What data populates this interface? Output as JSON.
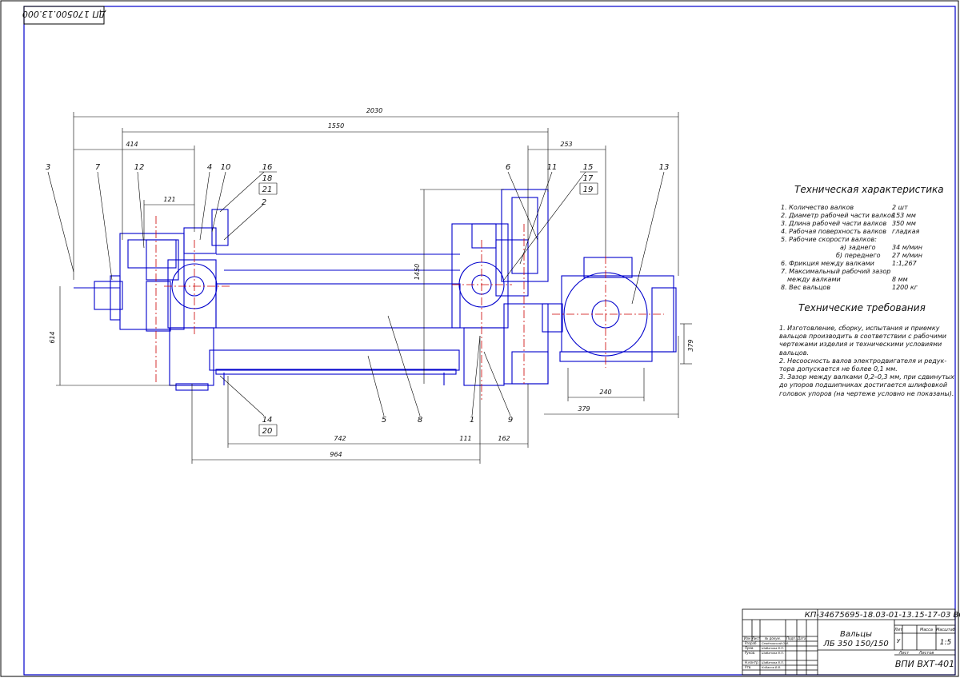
{
  "stamp_top": "ДП 170500.13.000",
  "dimensions": {
    "overall_length": "2030",
    "length_1550": "1550",
    "d414": "414",
    "d121": "121",
    "d253": "253",
    "height_1450": "1450",
    "height_614": "614",
    "height_379": "379",
    "d742": "742",
    "d111": "111",
    "d162": "162",
    "d964": "964",
    "d240": "240",
    "d379b": "379"
  },
  "callouts": [
    "3",
    "7",
    "12",
    "4",
    "10",
    "16",
    "18",
    "21",
    "2",
    "6",
    "11",
    "15",
    "17",
    "19",
    "13",
    "14",
    "20",
    "5",
    "8",
    "1",
    "9"
  ],
  "spec": {
    "title": "Техническая характеристика",
    "rows": [
      {
        "label": "1. Количество валков",
        "value": "2 шт"
      },
      {
        "label": "2. Диаметр рабочей части валков",
        "value": "153 мм"
      },
      {
        "label": "3. Длина рабочей части валков",
        "value": "350 мм"
      },
      {
        "label": "4. Рабочая поверхность валков",
        "value": "гладкая"
      },
      {
        "label": "5. Рабочие скорости валков:",
        "value": ""
      },
      {
        "label": "а) заднего",
        "value": "34 м/мин"
      },
      {
        "label": "б) переднего",
        "value": "27 м/мин"
      },
      {
        "label": "6. Фрикция между валками",
        "value": "1:1,267"
      },
      {
        "label": "7. Максимальный рабочий зазор",
        "value": ""
      },
      {
        "label": "между валками",
        "value": "8 мм"
      },
      {
        "label": "8. Вес вальцов",
        "value": "1200 кг"
      }
    ]
  },
  "requirements": {
    "title": "Технические требования",
    "items": [
      "1. Изготовление, сборку, испытания и приемку",
      "вальцов производить в соответствии с рабочими",
      "чертежами изделия и техническими условиями",
      "вальцов.",
      "2. Несоосность валов электродвигателя и редук-",
      "тора допускается не более 0,1 мм.",
      "3. Зазор между валками 0,2–0,3 мм, при сдвинутых",
      "до упоров подшипниках достигается шлифовкой",
      "головок упоров (на чертеже условно не показаны)."
    ]
  },
  "title_block": {
    "code": "КП-34675695-18.03-01-13.15-17-03 ВО",
    "name_line1": "Вальцы",
    "name_line2": "ЛБ 350 150/150",
    "lit_header": "Лит",
    "mass_header": "Масса",
    "scale_header": "Масштаб",
    "lit_value": "У",
    "scale_value": "1:5",
    "sheet_label": "Лист",
    "sheets_label": "Листов",
    "org": "ВПИ ВХТ-401",
    "hdr_izm": "Изм",
    "hdr_list": "Лист",
    "hdr_doc": "№ докум.",
    "hdr_sign": "Подп.",
    "hdr_date": "Дата",
    "role_razrab": "Разраб.",
    "role_prov": "Пров.",
    "role_ruk": "Руков.",
    "role_nkontr": "Н.контр.",
    "role_utv": "Утв.",
    "name_razrab": "Семёновский О.И.",
    "name_prov": "Шабанова В.П.",
    "name_ruk": "Шабанова В.П.",
    "name_nkontr": "Шабанова В.П.",
    "name_utv": "Кобанов В.В."
  }
}
